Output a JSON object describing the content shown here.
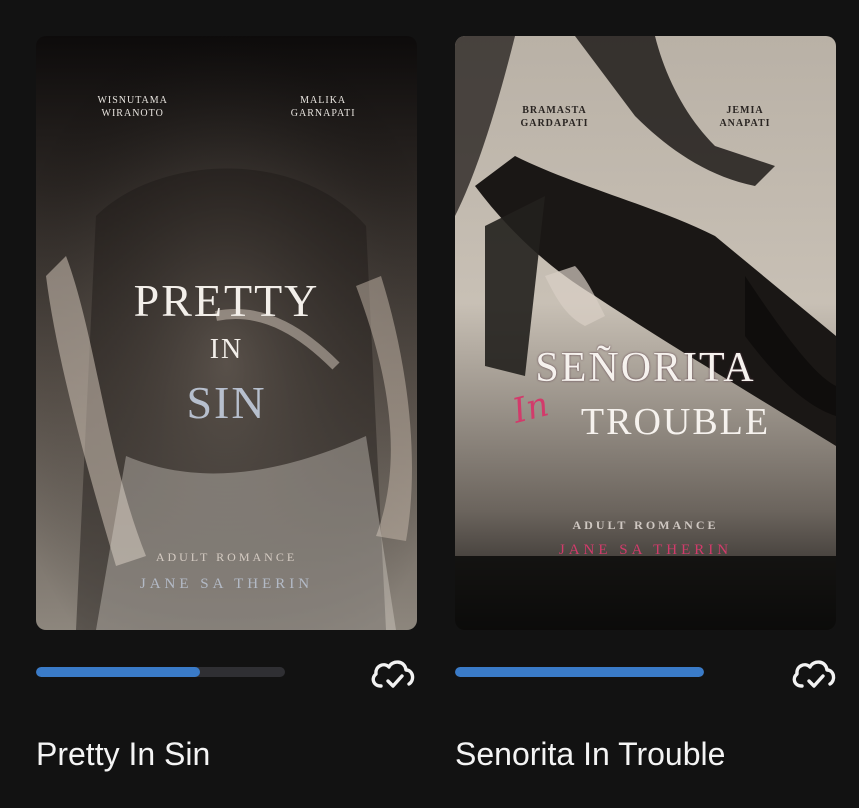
{
  "books": [
    {
      "title": "Pretty In Sin",
      "cover": {
        "author_left": "WISNUTAMA\nWIRANOTO",
        "author_right": "MALIKA\nGARNAPATI",
        "title_line1": "PRETTY",
        "title_line2": "IN",
        "title_line3": "SIN",
        "genre": "ADULT ROMANCE",
        "author": "JANE SA THERIN"
      },
      "progress": 0.66,
      "download_icon": "cloud-check-icon"
    },
    {
      "title": "Senorita In Trouble",
      "cover": {
        "author_left": "BRAMASTA\nGARDAPATI",
        "author_right": "JEMIA\nANAPATI",
        "title_line1": "SEÑORITA",
        "title_in": "In",
        "title_line2": "TROUBLE",
        "genre": "ADULT ROMANCE",
        "author": "JANE SA THERIN"
      },
      "progress": 1.0,
      "download_icon": "cloud-check-icon"
    }
  ],
  "colors": {
    "background": "#121212",
    "progress_fill": "#3a7bc8",
    "accent_pink": "#d23b6b"
  }
}
